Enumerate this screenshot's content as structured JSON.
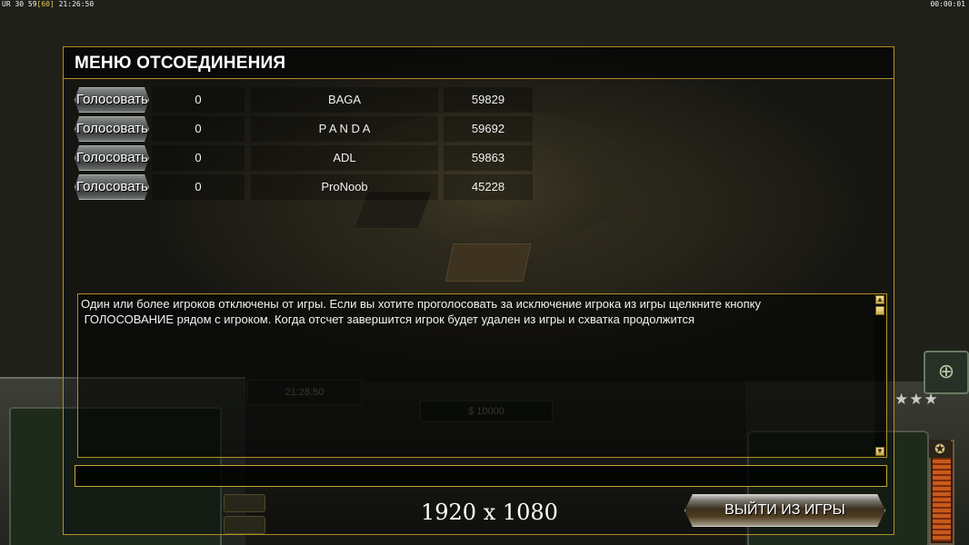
{
  "overlay": {
    "fps_prefix": "UR 30 59",
    "fps_bracket": "[60]",
    "fps_time": " 21:26:50",
    "clock": "00:00:01",
    "resolution": "1920 x 1080"
  },
  "hud": {
    "timer": "21:28:50",
    "cash": "$ 10000"
  },
  "dialog": {
    "title": "МЕНЮ ОТСОЕДИНЕНИЯ",
    "players": [
      {
        "vote_label": "Голосовать",
        "votes": "0",
        "name": "BAGA",
        "ping": "59829"
      },
      {
        "vote_label": "Голосовать",
        "votes": "0",
        "name": "P A N D A",
        "ping": "59692"
      },
      {
        "vote_label": "Голосовать",
        "votes": "0",
        "name": "ADL",
        "ping": "59863"
      },
      {
        "vote_label": "Голосовать",
        "votes": "0",
        "name": "ProNoob",
        "ping": "45228"
      }
    ],
    "message": "Один или более игроков отключены от игры. Если вы хотите проголосовать за исключение игрока из игры щелкните кнопку\n ГОЛОСОВАНИЕ рядом с игроком. Когда отсчет завершится игрок будет удален из игры и схватка продолжится",
    "chat_value": "",
    "exit_label": "ВЫЙТИ ИЗ ИГРЫ"
  },
  "colors": {
    "frame_gold": "#b28f27",
    "title_text": "#ffffff"
  }
}
